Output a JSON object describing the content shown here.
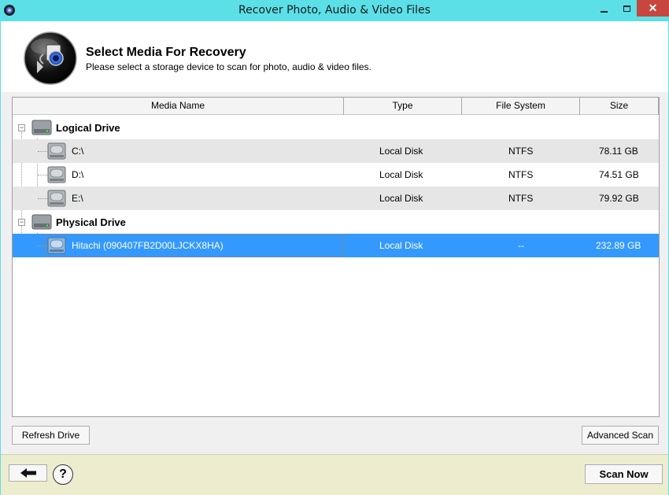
{
  "window": {
    "title": "Recover Photo, Audio & Video Files"
  },
  "header": {
    "title": "Select Media For Recovery",
    "subtitle": "Please select a storage device to scan for photo, audio & video files."
  },
  "columns": {
    "name": "Media Name",
    "type": "Type",
    "fs": "File System",
    "size": "Size"
  },
  "groups": {
    "logical": {
      "label": "Logical Drive",
      "items": [
        {
          "name": "C:\\",
          "type": "Local Disk",
          "fs": "NTFS",
          "size": "78.11 GB"
        },
        {
          "name": "D:\\",
          "type": "Local Disk",
          "fs": "NTFS",
          "size": "74.51 GB"
        },
        {
          "name": "E:\\",
          "type": "Local Disk",
          "fs": "NTFS",
          "size": "79.92 GB"
        }
      ]
    },
    "physical": {
      "label": "Physical Drive",
      "items": [
        {
          "name": "Hitachi (090407FB2D00LJCKX8HA)",
          "type": "Local Disk",
          "fs": "--",
          "size": "232.89 GB",
          "selected": true
        }
      ]
    }
  },
  "buttons": {
    "refresh": "Refresh Drive",
    "advanced": "Advanced Scan",
    "scan": "Scan Now",
    "help": "?"
  },
  "colors": {
    "titlebar": "#5be0e8",
    "selection": "#3399ff",
    "close": "#c7463f",
    "footer": "#eeeccf"
  },
  "icons": [
    "app-icon",
    "recovery-logo-icon",
    "minimize-icon",
    "maximize-icon",
    "close-icon",
    "hard-drive-icon",
    "back-arrow-icon",
    "help-icon"
  ]
}
